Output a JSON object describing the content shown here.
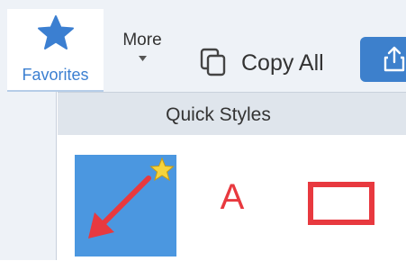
{
  "toolbar": {
    "favorites_label": "Favorites",
    "more_label": "More",
    "copy_all_label": "Copy All"
  },
  "panel": {
    "title": "Quick Styles",
    "styles": [
      {
        "kind": "arrow",
        "favorite": true,
        "color": "#e8393f"
      },
      {
        "kind": "text",
        "label": "A",
        "color": "#e8393f"
      },
      {
        "kind": "rectangle",
        "color": "#e8393f"
      }
    ]
  },
  "colors": {
    "accent": "#3b7fd1",
    "share_button": "#3d80cc",
    "tile_background": "#4b97e0",
    "star": "#f5d33c",
    "style_red": "#e8393f"
  },
  "icons": [
    "star-icon",
    "chevron-down-icon",
    "copy-icon",
    "share-icon"
  ]
}
